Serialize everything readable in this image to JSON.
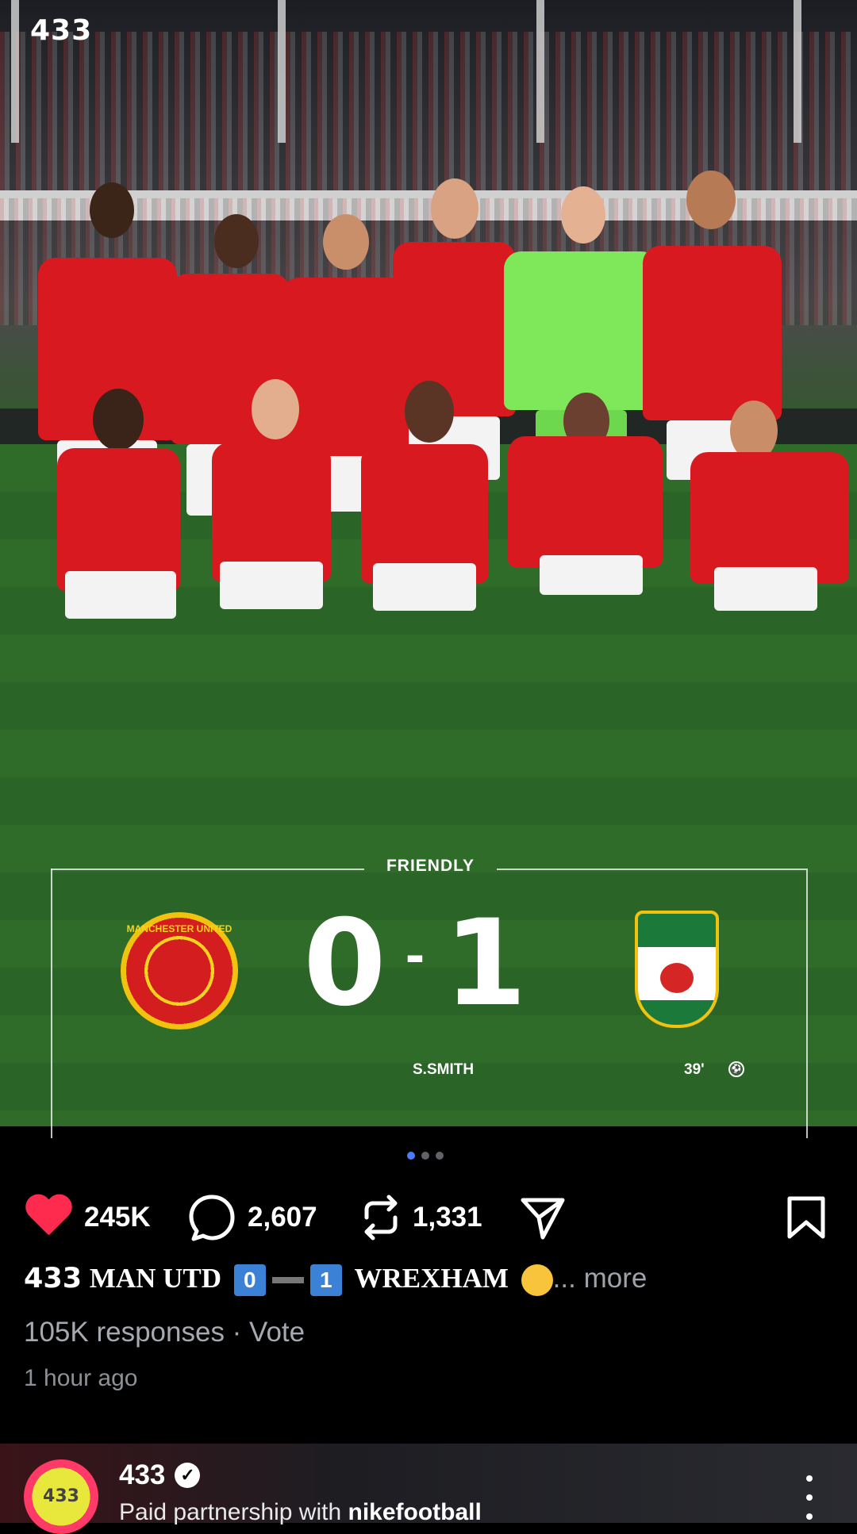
{
  "app": {
    "brand": "433"
  },
  "post": {
    "match_card": {
      "label": "FRIENDLY",
      "home_team_crest": "manchester-united-crest",
      "home_crest_text": "MANCHESTER UNITED",
      "home_score": "0",
      "separator": "-",
      "away_score": "1",
      "away_team_crest": "wrexham-crest",
      "scorer": "S.SMITH",
      "minute": "39'"
    },
    "carousel": {
      "total": 3,
      "active": 1
    },
    "actions": {
      "likes": "245K",
      "comments": "2,607",
      "reposts": "1,331"
    },
    "caption": {
      "brand": "433",
      "home": "MAN UTD",
      "home_score": "0",
      "away_score": "1",
      "away": "WREXHAM",
      "more": "... more"
    },
    "poll": "105K responses · Vote",
    "timestamp": "1 hour ago"
  },
  "next_post": {
    "avatar_text": "433",
    "account": "433",
    "partnership_prefix": "Paid partnership with ",
    "partner": "nikefootball"
  },
  "colors": {
    "like": "#ff2b4f",
    "carousel_active": "#4b7bff",
    "score_badge": "#3b82d6"
  }
}
